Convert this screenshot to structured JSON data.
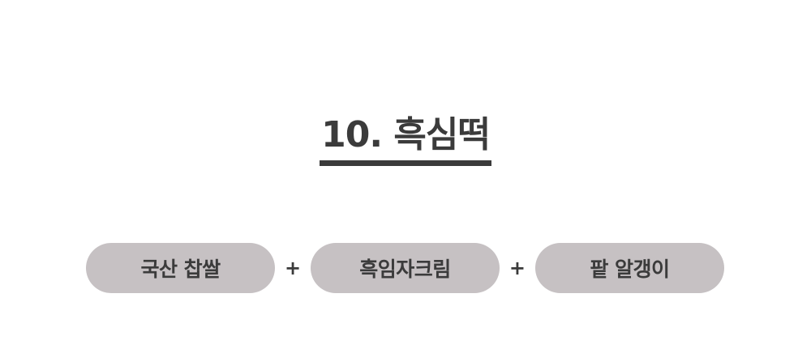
{
  "title": "10. 흑심떡",
  "ingredients": [
    {
      "label": "국산 찹쌀"
    },
    {
      "label": "흑임자크림"
    },
    {
      "label": "팥 알갱이"
    }
  ],
  "separator": "+",
  "colors": {
    "text": "#3b3b3b",
    "pill_background": "#c6c1c3",
    "background": "#ffffff"
  }
}
